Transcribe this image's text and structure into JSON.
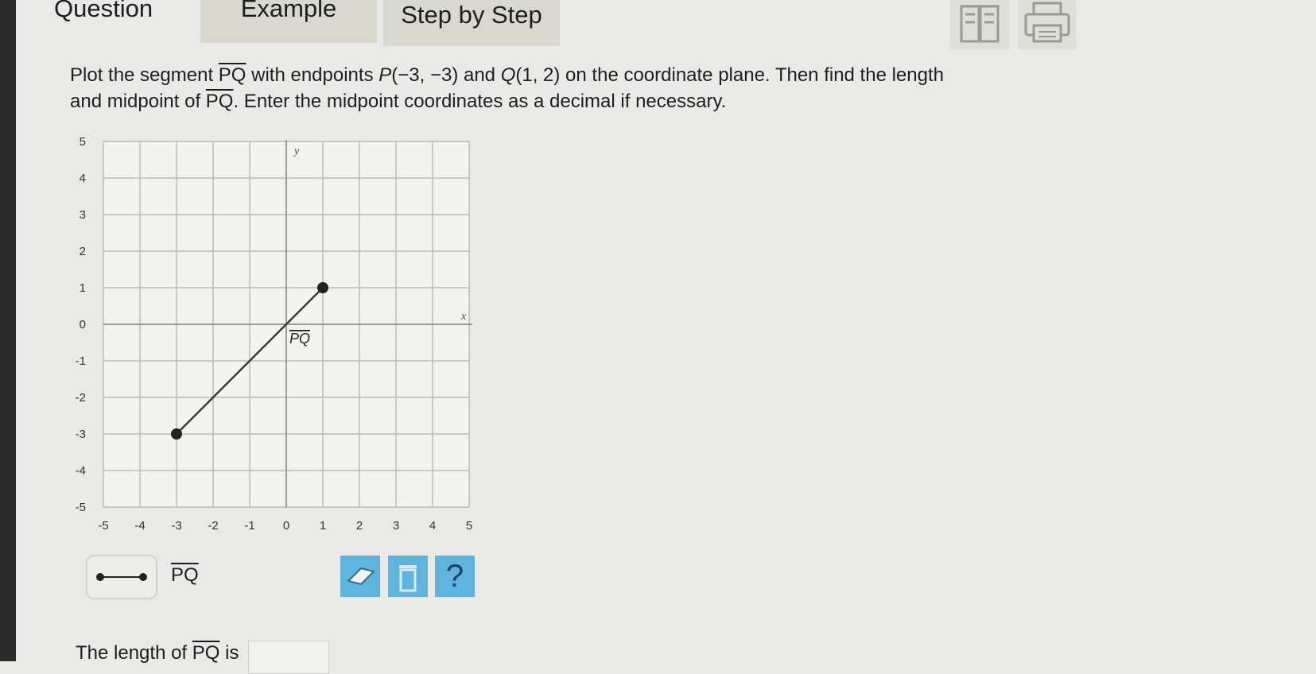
{
  "tabs": {
    "question": "Question",
    "example": "Example",
    "step_by_step": "Step by Step"
  },
  "toolbar": {
    "reference_icon": "book-icon",
    "print_icon": "printer-icon"
  },
  "prompt": {
    "line1_a": "Plot the segment ",
    "segment": "PQ",
    "line1_b": " with endpoints ",
    "p_name": "P",
    "p_coords": "(−3, −3)",
    "and": " and ",
    "q_name": "Q",
    "q_coords": "(1, 2)",
    "line1_c": " on the coordinate plane. Then find the length",
    "line2_a": "and midpoint of ",
    "line2_b": ". Enter the midpoint coordinates as a decimal if necessary."
  },
  "graph": {
    "x_axis_label": "x",
    "y_axis_label": "y",
    "x_ticks": [
      "-5",
      "-4",
      "-3",
      "-2",
      "-1",
      "0",
      "1",
      "2",
      "3",
      "4",
      "5"
    ],
    "y_ticks": [
      "5",
      "4",
      "3",
      "2",
      "1",
      "0",
      "-1",
      "-2",
      "-3",
      "-4",
      "-5"
    ],
    "segment_label": "PQ",
    "segment": {
      "p": [
        -3,
        -3
      ],
      "q": [
        1,
        1
      ]
    },
    "x_range": [
      -5,
      5
    ],
    "y_range": [
      -5,
      5
    ]
  },
  "palette": {
    "tool_label": "PQ"
  },
  "controls": {
    "eraser": "eraser-icon",
    "trash": "trash-icon",
    "help_label": "?"
  },
  "answer": {
    "length_prefix": "The length of ",
    "length_segment": "PQ",
    "length_suffix": " is"
  },
  "colors": {
    "accent_button": "#5fb4de",
    "tab_bg": "#d9d8cf",
    "grid_line": "#bbbbbb"
  }
}
